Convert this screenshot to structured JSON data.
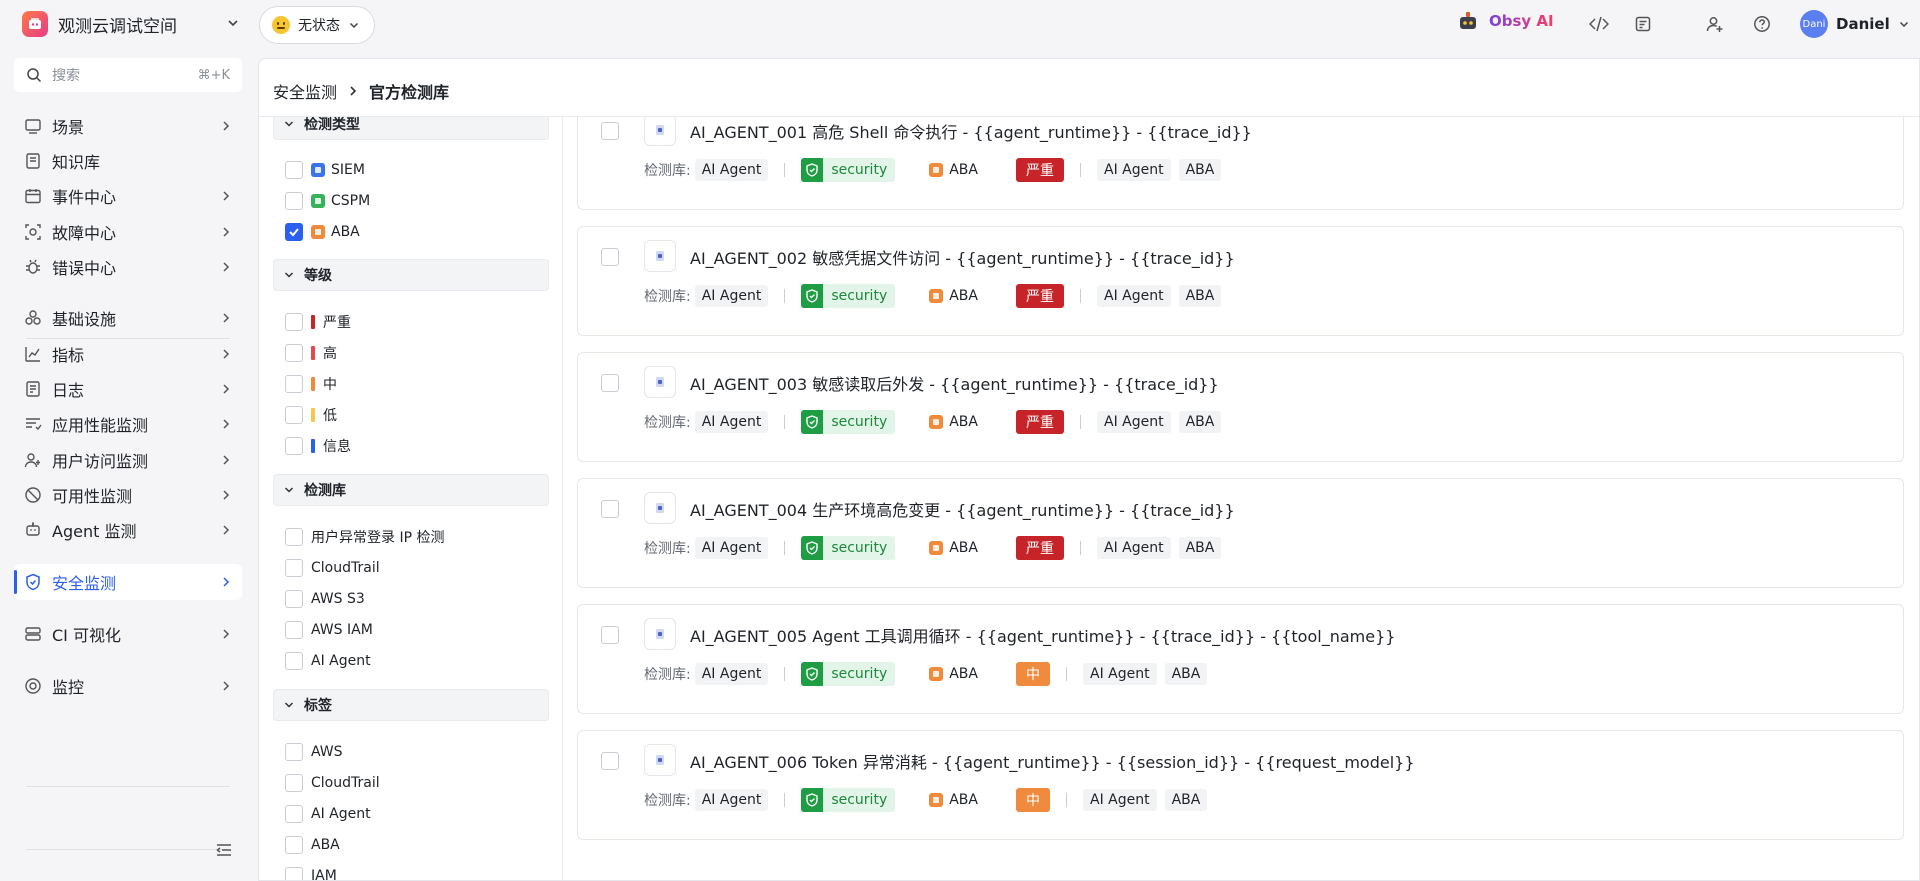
{
  "topbar": {
    "workspace_name": "观测云调试空间",
    "status_label": "无状态",
    "ai_label": "Obsy AI",
    "avatar_text": "Dani",
    "user_name": "Daniel"
  },
  "sidebar": {
    "search_placeholder": "搜索",
    "search_shortcut": "⌘+K",
    "items": [
      {
        "label": "场景",
        "icon": "scene-icon",
        "arrow": true
      },
      {
        "label": "知识库",
        "icon": "book-icon",
        "arrow": false
      },
      {
        "label": "事件中心",
        "icon": "calendar-icon",
        "arrow": true
      },
      {
        "label": "故障中心",
        "icon": "incident-icon",
        "arrow": true
      },
      {
        "label": "错误中心",
        "icon": "bug-icon",
        "arrow": true
      },
      {
        "label": "基础设施",
        "icon": "infrastructure-icon",
        "arrow": true
      },
      {
        "label": "指标",
        "icon": "metrics-icon",
        "arrow": true
      },
      {
        "label": "日志",
        "icon": "log-icon",
        "arrow": true
      },
      {
        "label": "应用性能监测",
        "icon": "apm-icon",
        "arrow": true
      },
      {
        "label": "用户访问监测",
        "icon": "rum-icon",
        "arrow": true
      },
      {
        "label": "可用性监测",
        "icon": "availability-icon",
        "arrow": true
      },
      {
        "label": "Agent 监测",
        "icon": "agent-icon",
        "arrow": true
      },
      {
        "label": "安全监测",
        "icon": "shield-icon",
        "arrow": true,
        "active": true
      },
      {
        "label": "CI 可视化",
        "icon": "ci-icon",
        "arrow": true
      },
      {
        "label": "监控",
        "icon": "monitor-icon",
        "arrow": true
      }
    ]
  },
  "breadcrumb": {
    "parent": "安全监测",
    "current": "官方检测库"
  },
  "filters": {
    "type": {
      "title": "检测类型",
      "options": [
        {
          "label": "SIEM",
          "checked": false,
          "color": "#3b73e8"
        },
        {
          "label": "CSPM",
          "checked": false,
          "color": "#34b35a"
        },
        {
          "label": "ABA",
          "checked": true,
          "color": "#f08a3c"
        }
      ]
    },
    "level": {
      "title": "等级",
      "options": [
        {
          "label": "严重",
          "color": "#c7242a"
        },
        {
          "label": "高",
          "color": "#e5484d"
        },
        {
          "label": "中",
          "color": "#f08a3c"
        },
        {
          "label": "低",
          "color": "#f5c84c"
        },
        {
          "label": "信息",
          "color": "#2b5ff0"
        }
      ]
    },
    "library": {
      "title": "检测库",
      "options": [
        "用户异常登录 IP 检测",
        "CloudTrail",
        "AWS S3",
        "AWS IAM",
        "AI Agent"
      ]
    },
    "tags": {
      "title": "标签",
      "options": [
        "AWS",
        "CloudTrail",
        "AI Agent",
        "ABA",
        "IAM"
      ]
    }
  },
  "rules": {
    "meta_label": "检测库:",
    "items": [
      {
        "title": "AI_AGENT_001 高危 Shell 命令执行 - {{agent_runtime}} - {{trace_id}}",
        "library": "AI Agent",
        "category": "security",
        "type": "ABA",
        "severity": "严重",
        "severity_level": "critical",
        "tags": [
          "AI Agent",
          "ABA"
        ]
      },
      {
        "title": "AI_AGENT_002 敏感凭据文件访问 - {{agent_runtime}} - {{trace_id}}",
        "library": "AI Agent",
        "category": "security",
        "type": "ABA",
        "severity": "严重",
        "severity_level": "critical",
        "tags": [
          "AI Agent",
          "ABA"
        ]
      },
      {
        "title": "AI_AGENT_003 敏感读取后外发 - {{agent_runtime}} - {{trace_id}}",
        "library": "AI Agent",
        "category": "security",
        "type": "ABA",
        "severity": "严重",
        "severity_level": "critical",
        "tags": [
          "AI Agent",
          "ABA"
        ]
      },
      {
        "title": "AI_AGENT_004 生产环境高危变更 - {{agent_runtime}} - {{trace_id}}",
        "library": "AI Agent",
        "category": "security",
        "type": "ABA",
        "severity": "严重",
        "severity_level": "critical",
        "tags": [
          "AI Agent",
          "ABA"
        ]
      },
      {
        "title": "AI_AGENT_005 Agent 工具调用循环 - {{agent_runtime}} - {{trace_id}} - {{tool_name}}",
        "library": "AI Agent",
        "category": "security",
        "type": "ABA",
        "severity": "中",
        "severity_level": "medium",
        "tags": [
          "AI Agent",
          "ABA"
        ]
      },
      {
        "title": "AI_AGENT_006 Token 异常消耗 - {{agent_runtime}} - {{session_id}} - {{request_model}}",
        "library": "AI Agent",
        "category": "security",
        "type": "ABA",
        "severity": "中",
        "severity_level": "medium",
        "tags": [
          "AI Agent",
          "ABA"
        ]
      }
    ]
  },
  "colors": {
    "accent": "#2b5ff0",
    "critical": "#c7242a",
    "medium": "#f08a3c",
    "security_green": "#1f9d45"
  }
}
